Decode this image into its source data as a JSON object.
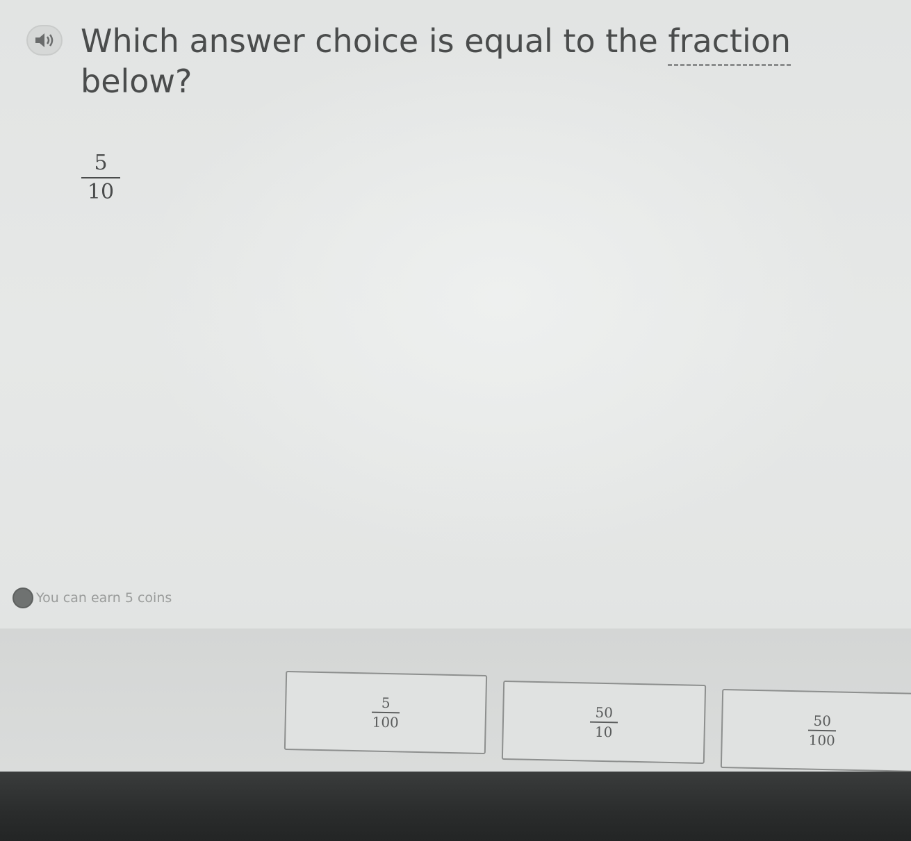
{
  "question": {
    "text_before": "Which answer choice is equal to the ",
    "vocab_word": "fraction",
    "text_after": " below?",
    "fraction": {
      "numerator": "5",
      "denominator": "10"
    }
  },
  "coins": {
    "text": "You can earn 5 coins"
  },
  "choices": [
    {
      "numerator": "5",
      "denominator": "100"
    },
    {
      "numerator": "50",
      "denominator": "10"
    },
    {
      "numerator": "50",
      "denominator": "100"
    }
  ],
  "icons": {
    "audio": "speaker-icon",
    "coin": "coin-icon"
  }
}
